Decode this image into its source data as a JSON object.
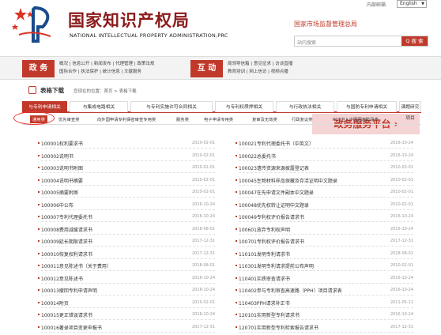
{
  "header": {
    "org_cn": "国家知识产权局",
    "org_en": "NATIONAL INTELLECTUAL PROPERTY ADMINISTRATION,PRC",
    "top_link": "内部邮箱",
    "lang": "English",
    "samr": "国家市场监督管理总局",
    "search_placeholder": "站内搜索",
    "search_btn": "Q 搜 索"
  },
  "nav": {
    "tag1": "政 务",
    "links1_row1": "概况 | 信息公开 | 新闻发布 | 代理管理 | 政策法规",
    "links1_row2": "国际合作 | 执法保护 | 统计信息 | 文献服务",
    "tag2": "互 动",
    "links2_row1": "局领导信箱 | 意见征求 | 访谈直播",
    "links2_row2": "教育培训 | 网上信访 | 视频点播",
    "banner": "政务服务平台 ›"
  },
  "crumb": {
    "title": "表格下载",
    "loc": "您现在的位置：首页 > 表格下载"
  },
  "tabs": [
    "与专利申请相关",
    "与集成电路相关",
    "与专利实施许可合同相关",
    "与专利权质押相关",
    "与行政执法相关",
    "与国防专利申请相关",
    "课题研究项目"
  ],
  "subtabs": [
    "通用类",
    "优先审查类",
    "向外国申请专利保密审查专用类",
    "服务类",
    "电子申请专用类",
    "复审及无效类",
    "行政复议类",
    "PCT进入中国国家阶段类"
  ],
  "left": [
    [
      "100001权利要求书",
      "2010-02-01"
    ],
    [
      "100002说明书",
      "2010-02-01"
    ],
    [
      "100003说明书附图",
      "2010-02-01"
    ],
    [
      "100004说明书摘要",
      "2010-02-01"
    ],
    [
      "100005摘要附图",
      "2010-02-01"
    ],
    [
      "100006中公布",
      "2016-10-24"
    ],
    [
      "100007专利代理委托书",
      "2016-10-24"
    ],
    [
      "100008费用减缓请求书",
      "2018-08-01"
    ],
    [
      "100009延长期限请求书",
      "2017-12-31"
    ],
    [
      "100010恢复权利请求书",
      "2017-12-31"
    ],
    [
      "100011意见陈述书（关于费用）",
      "2018-08-01"
    ],
    [
      "100012意见陈述书",
      "2016-10-24"
    ],
    [
      "100013撤回专利申请声明",
      "2016-10-24"
    ],
    [
      "100014附页",
      "2010-02-01"
    ],
    [
      "100015更正错误请求书",
      "2016-10-24"
    ],
    [
      "100016著录项目变更申报书",
      "2017-12-31"
    ]
  ],
  "right": [
    [
      "100021专利代理委托书（中英文）",
      "2016-10-24"
    ],
    [
      "100022总委托书",
      "2016-10-24"
    ],
    [
      "100023遗传资源来源披露登记表",
      "2010-02-01"
    ],
    [
      "100045生物材料样品保藏及存活证明中文题录",
      "2010-02-01"
    ],
    [
      "100047在先申请文件副本中文题录",
      "2010-02-01"
    ],
    [
      "100048优先权转让证明中文题录",
      "2010-02-01"
    ],
    [
      "100049专利权评价报告请求书",
      "2016-10-24"
    ],
    [
      "100601放弃专利权声明",
      "2016-10-24"
    ],
    [
      "100701专利权评价报告请求书",
      "2017-12-31"
    ],
    [
      "110101发明专利请求书",
      "2018-08-01"
    ],
    [
      "110301发明专利请求提前公布声明",
      "2010-02-01"
    ],
    [
      "110401实质审查请求书",
      "2016-10-24"
    ],
    [
      "110402参与专利审查高速路（PPH）项目请求表",
      "2016-10-24"
    ],
    [
      "110403PPH请求补正书",
      "2011-05-11"
    ],
    [
      "120101实用新型专利请求书",
      "2016-10-24"
    ],
    [
      "120701实用新型专利检索报告请求书",
      "2017-12-31"
    ]
  ]
}
